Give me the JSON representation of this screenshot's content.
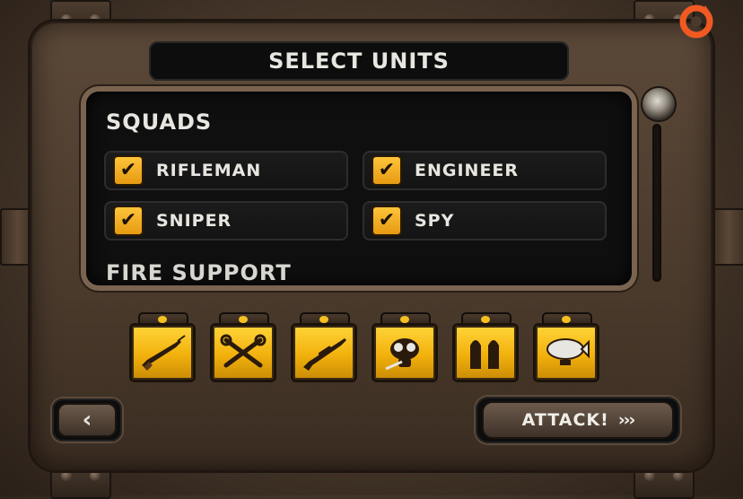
{
  "header": {
    "title": "SELECT UNITS"
  },
  "squads": {
    "title": "SQUADS",
    "units": [
      {
        "label": "RIFLEMAN",
        "checked": true,
        "check_mark": "✔"
      },
      {
        "label": "ENGINEER",
        "checked": true,
        "check_mark": "✔"
      },
      {
        "label": "SNIPER",
        "checked": true,
        "check_mark": "✔"
      },
      {
        "label": "SPY",
        "checked": true,
        "check_mark": "✔"
      }
    ]
  },
  "fire_support": {
    "title": "FIRE SUPPORT"
  },
  "unit_tray": {
    "items": [
      {
        "icon": "rifle-bayonet-icon"
      },
      {
        "icon": "wrench-tools-icon"
      },
      {
        "icon": "sniper-rifle-icon"
      },
      {
        "icon": "gas-mask-icon"
      },
      {
        "icon": "artillery-shells-icon"
      },
      {
        "icon": "zeppelin-icon"
      }
    ]
  },
  "controls": {
    "back_symbol": "‹",
    "attack_label": "ATTACK!",
    "attack_arrows": "›››"
  },
  "colors": {
    "accent": "#f2b10c",
    "checkbox": "#ffc43a",
    "brand_logo": "#f05a22"
  }
}
